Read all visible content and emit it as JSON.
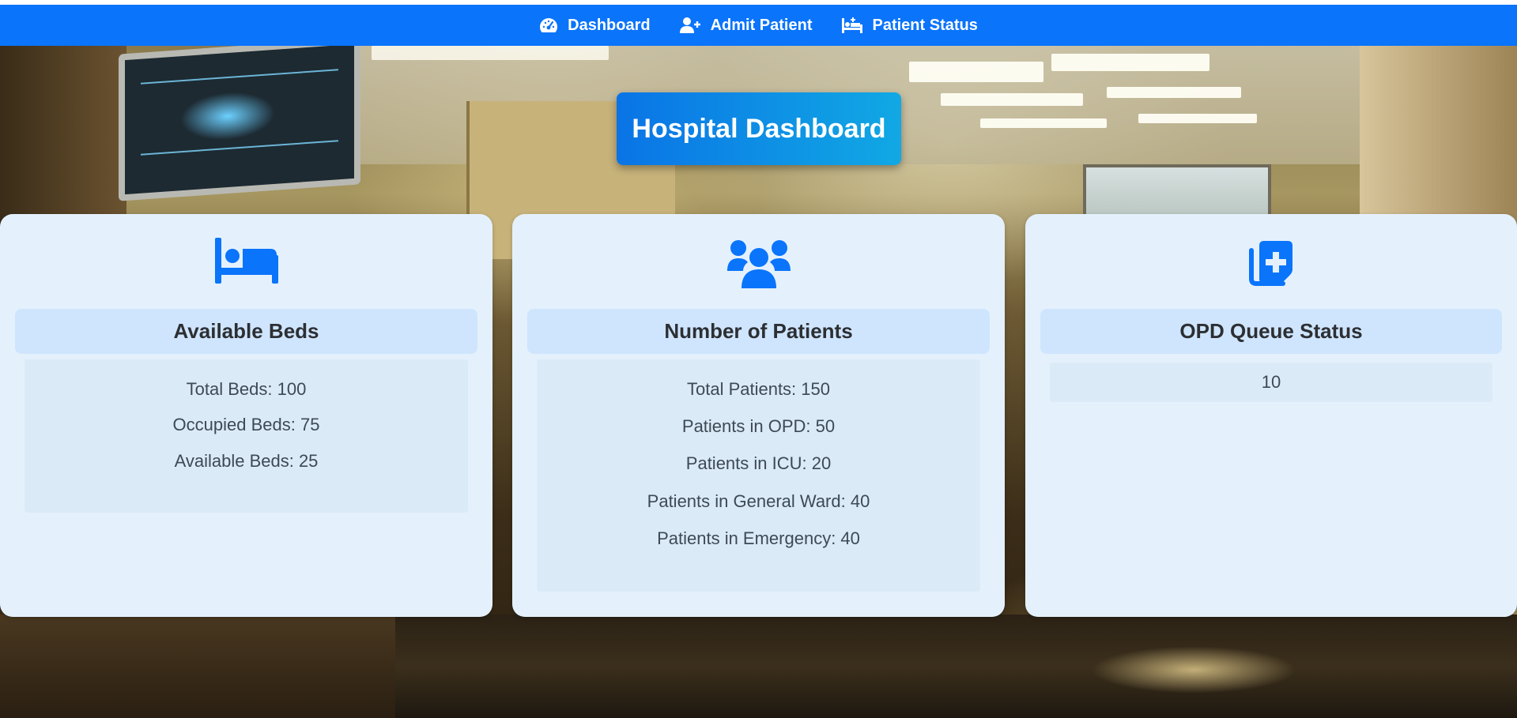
{
  "nav": {
    "items": [
      {
        "label": "Dashboard",
        "icon": "gauge-icon"
      },
      {
        "label": "Admit Patient",
        "icon": "user-plus-icon"
      },
      {
        "label": "Patient Status",
        "icon": "hospital-bed-icon"
      }
    ]
  },
  "page": {
    "title": "Hospital Dashboard"
  },
  "cards": [
    {
      "title": "Available Beds",
      "icon": "bed-icon",
      "lines": [
        "Total Beds: 100",
        "Occupied Beds: 75",
        "Available Beds: 25"
      ]
    },
    {
      "title": "Number of Patients",
      "icon": "users-icon",
      "lines": [
        "Total Patients: 150",
        "Patients in OPD: 50",
        "Patients in ICU: 20",
        "Patients in General Ward: 40",
        "Patients in Emergency: 40"
      ]
    },
    {
      "title": "OPD Queue Status",
      "icon": "medical-plus-icon",
      "queue_value": "10"
    }
  ],
  "colors": {
    "navbar": "#0a74fb",
    "accent_icon": "#0a74fb",
    "card_bg": "#e4f1fd",
    "card_heading_bg": "#cfe5fd"
  }
}
